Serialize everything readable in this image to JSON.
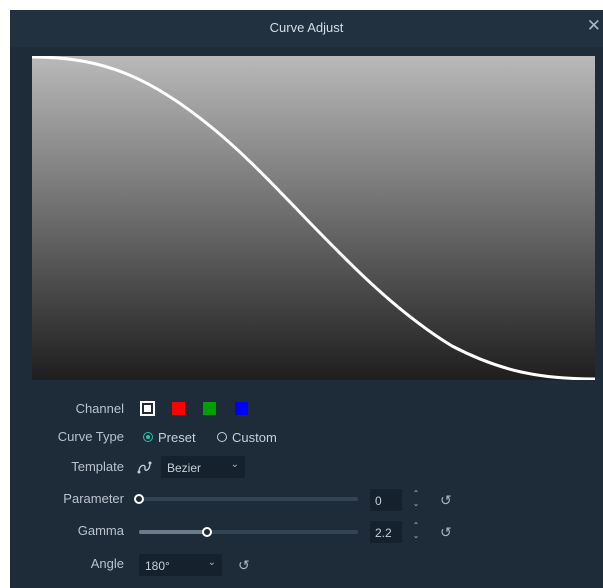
{
  "window": {
    "title": "Curve Adjust",
    "close_glyph": "✕"
  },
  "channel": {
    "label": "Channel",
    "swatches": [
      {
        "name": "white",
        "color": "#ffffff",
        "selected": true
      },
      {
        "name": "red",
        "color": "#ff0000",
        "selected": false
      },
      {
        "name": "green",
        "color": "#00a000",
        "selected": false
      },
      {
        "name": "blue",
        "color": "#0000ff",
        "selected": false
      }
    ]
  },
  "curve_type": {
    "label": "Curve Type",
    "options": [
      "Preset",
      "Custom"
    ],
    "selected": "Preset"
  },
  "template": {
    "label": "Template",
    "value": "Bezier",
    "icon": "bezier-curve-icon"
  },
  "parameter": {
    "label": "Parameter",
    "value": "0",
    "level": 0.0
  },
  "gamma": {
    "label": "Gamma",
    "value": "2.2",
    "level": 0.31
  },
  "angle": {
    "label": "Angle",
    "value": "180°"
  },
  "colors": {
    "accent": "#21c4a7",
    "background": "#1e2b38",
    "titlebar": "#223140"
  }
}
